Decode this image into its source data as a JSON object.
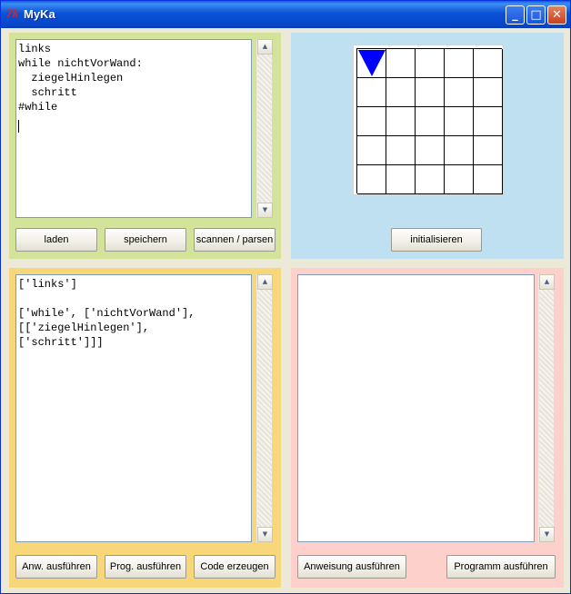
{
  "window": {
    "title": "MyKa",
    "icon": "tk-icon",
    "minimize": "_",
    "maximize": "□",
    "close": "✕"
  },
  "editor": {
    "code": "links\nwhile nichtVorWand:\n  ziegelHinlegen\n  schritt\n#while",
    "buttons": {
      "load": "laden",
      "save": "speichern",
      "parse": "scannen / parsen"
    }
  },
  "world": {
    "rows": 5,
    "cols": 5,
    "robot": {
      "row": 0,
      "col": 0,
      "direction": "south",
      "color": "#0000ff"
    },
    "init_button": "initialisieren"
  },
  "parse_output": {
    "text": "['links']\n\n['while', ['nichtVorWand'],\n[['ziegelHinlegen'],\n['schritt']]]",
    "buttons": {
      "run_statement": "Anw. ausführen",
      "run_program": "Prog. ausführen",
      "generate_code": "Code erzeugen"
    }
  },
  "code_output": {
    "text": "",
    "buttons": {
      "run_statement": "Anweisung ausführen",
      "run_program": "Programm ausführen"
    }
  },
  "colors": {
    "panel_editor": "#d3e39a",
    "panel_world": "#bfe0f0",
    "panel_parse": "#f7d77a",
    "panel_code": "#fdd0cc"
  }
}
